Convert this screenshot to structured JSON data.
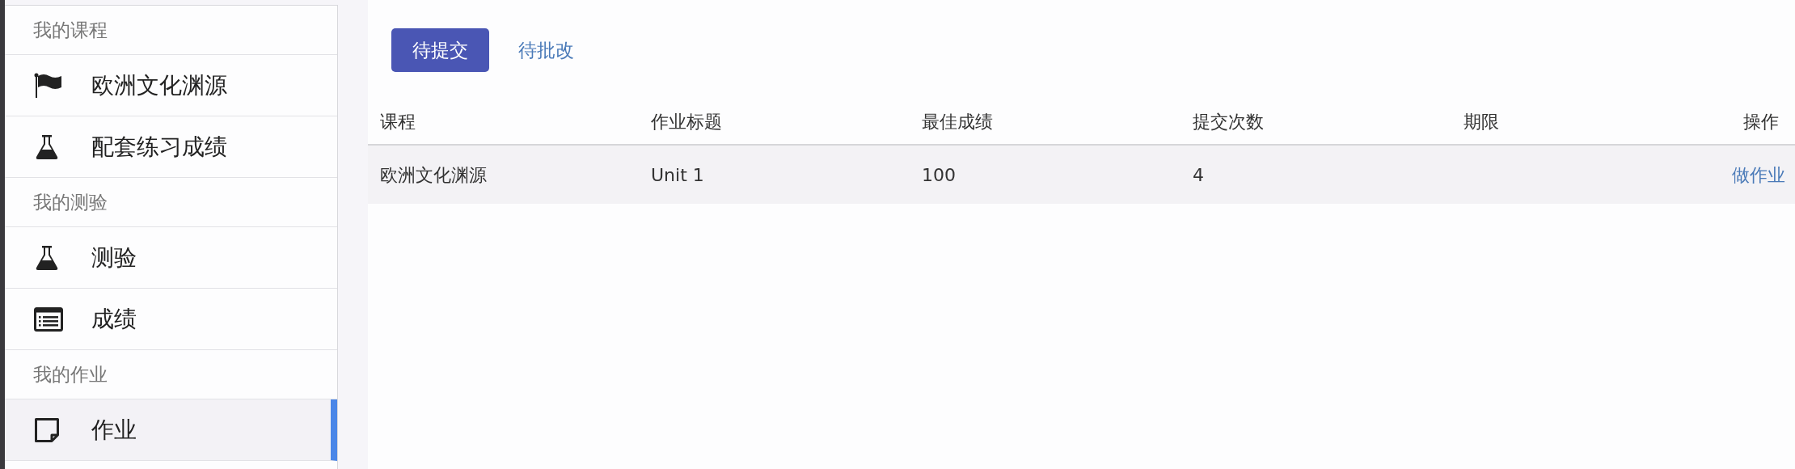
{
  "sidebar": {
    "sections": [
      {
        "title": "我的课程",
        "items": [
          {
            "label": "欧洲文化渊源",
            "kind": "flag",
            "selected": false
          },
          {
            "label": "配套练习成绩",
            "kind": "flask",
            "selected": false
          }
        ]
      },
      {
        "title": "我的测验",
        "items": [
          {
            "label": "测验",
            "kind": "flask",
            "selected": false
          },
          {
            "label": "成绩",
            "kind": "list",
            "selected": false
          }
        ]
      },
      {
        "title": "我的作业",
        "items": [
          {
            "label": "作业",
            "kind": "note",
            "selected": true
          }
        ]
      }
    ]
  },
  "tabs": [
    {
      "label": "待提交",
      "selected": true
    },
    {
      "label": "待批改",
      "selected": false
    }
  ],
  "table": {
    "columns": [
      "课程",
      "作业标题",
      "最佳成绩",
      "提交次数",
      "期限",
      "操作"
    ],
    "rows": [
      {
        "cells": [
          "欧洲文化渊源",
          "Unit 1",
          "100",
          "4"
        ],
        "action": "做作业"
      }
    ]
  }
}
